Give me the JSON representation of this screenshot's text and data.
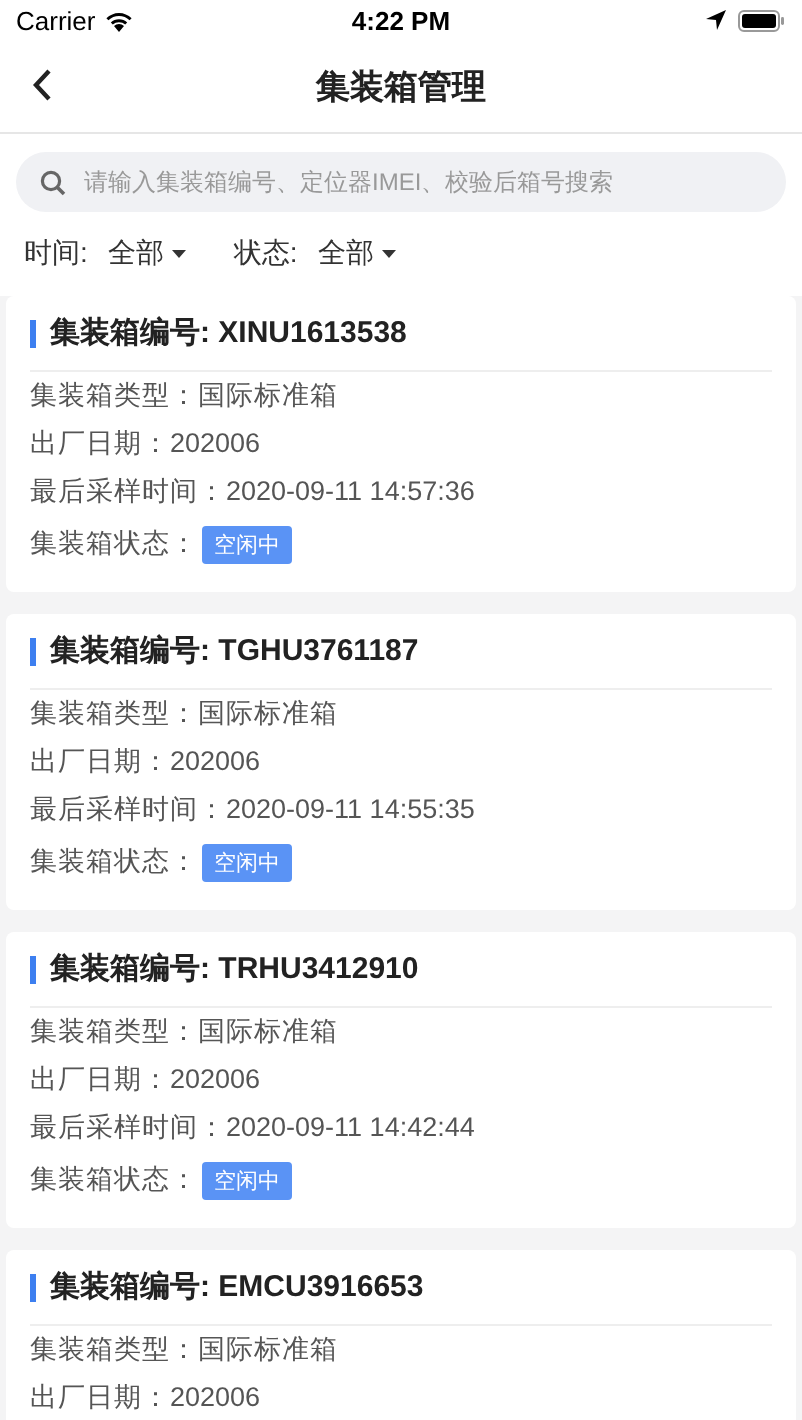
{
  "status_bar": {
    "carrier": "Carrier",
    "time": "4:22 PM"
  },
  "nav": {
    "title": "集装箱管理"
  },
  "search": {
    "placeholder": "请输入集装箱编号、定位器IMEI、校验后箱号搜索"
  },
  "filters": [
    {
      "label": "时间:",
      "value": "全部"
    },
    {
      "label": "状态:",
      "value": "全部"
    }
  ],
  "cards": [
    {
      "title": "集装箱编号: XINU1613538",
      "fields": [
        {
          "kind": "text",
          "label": "集装箱类型：",
          "value": "国际标准箱"
        },
        {
          "kind": "text",
          "label": "出厂日期：",
          "value": "202006"
        },
        {
          "kind": "text",
          "label": "最后采样时间：",
          "value": "2020-09-11 14:57:36"
        },
        {
          "kind": "badge",
          "label": "集装箱状态：",
          "value": "空闲中"
        }
      ]
    },
    {
      "title": "集装箱编号: TGHU3761187",
      "fields": [
        {
          "kind": "text",
          "label": "集装箱类型：",
          "value": "国际标准箱"
        },
        {
          "kind": "text",
          "label": "出厂日期：",
          "value": "202006"
        },
        {
          "kind": "text",
          "label": "最后采样时间：",
          "value": "2020-09-11 14:55:35"
        },
        {
          "kind": "badge",
          "label": "集装箱状态：",
          "value": "空闲中"
        }
      ]
    },
    {
      "title": "集装箱编号: TRHU3412910",
      "fields": [
        {
          "kind": "text",
          "label": "集装箱类型：",
          "value": "国际标准箱"
        },
        {
          "kind": "text",
          "label": "出厂日期：",
          "value": "202006"
        },
        {
          "kind": "text",
          "label": "最后采样时间：",
          "value": "2020-09-11 14:42:44"
        },
        {
          "kind": "badge",
          "label": "集装箱状态：",
          "value": "空闲中"
        }
      ]
    },
    {
      "title": "集装箱编号: EMCU3916653",
      "fields": [
        {
          "kind": "text",
          "label": "集装箱类型：",
          "value": "国际标准箱"
        },
        {
          "kind": "text",
          "label": "出厂日期：",
          "value": "202006"
        }
      ]
    }
  ]
}
